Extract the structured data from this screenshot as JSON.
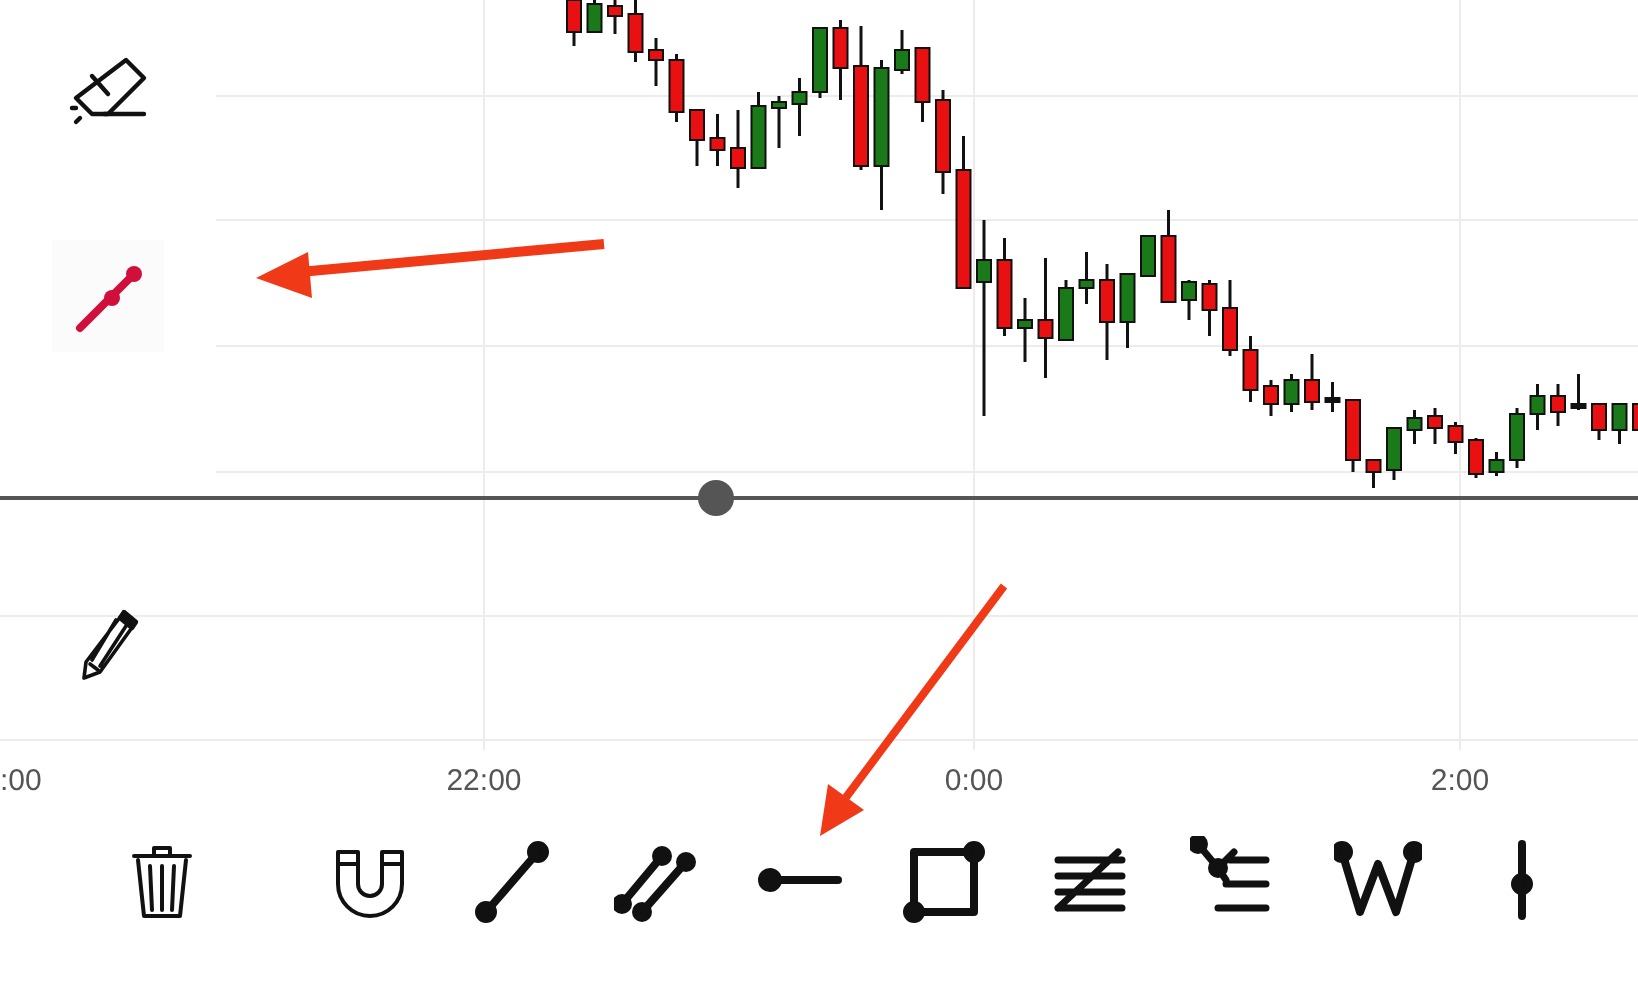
{
  "side_tools": [
    {
      "kind": "eraser",
      "selected": false
    },
    {
      "kind": "line",
      "selected": true
    },
    {
      "kind": "pencil",
      "selected": false
    }
  ],
  "time_axis": [
    ":00",
    "22:00",
    "0:00",
    "2:00"
  ],
  "bottom_tools": [
    {
      "kind": "trash"
    },
    {
      "kind": "magnet"
    },
    {
      "kind": "trend-line"
    },
    {
      "kind": "parallel"
    },
    {
      "kind": "horizontal-ray"
    },
    {
      "kind": "rectangle"
    },
    {
      "kind": "fib"
    },
    {
      "kind": "pitchfork"
    },
    {
      "kind": "pattern"
    },
    {
      "kind": "vertical-line"
    }
  ]
}
